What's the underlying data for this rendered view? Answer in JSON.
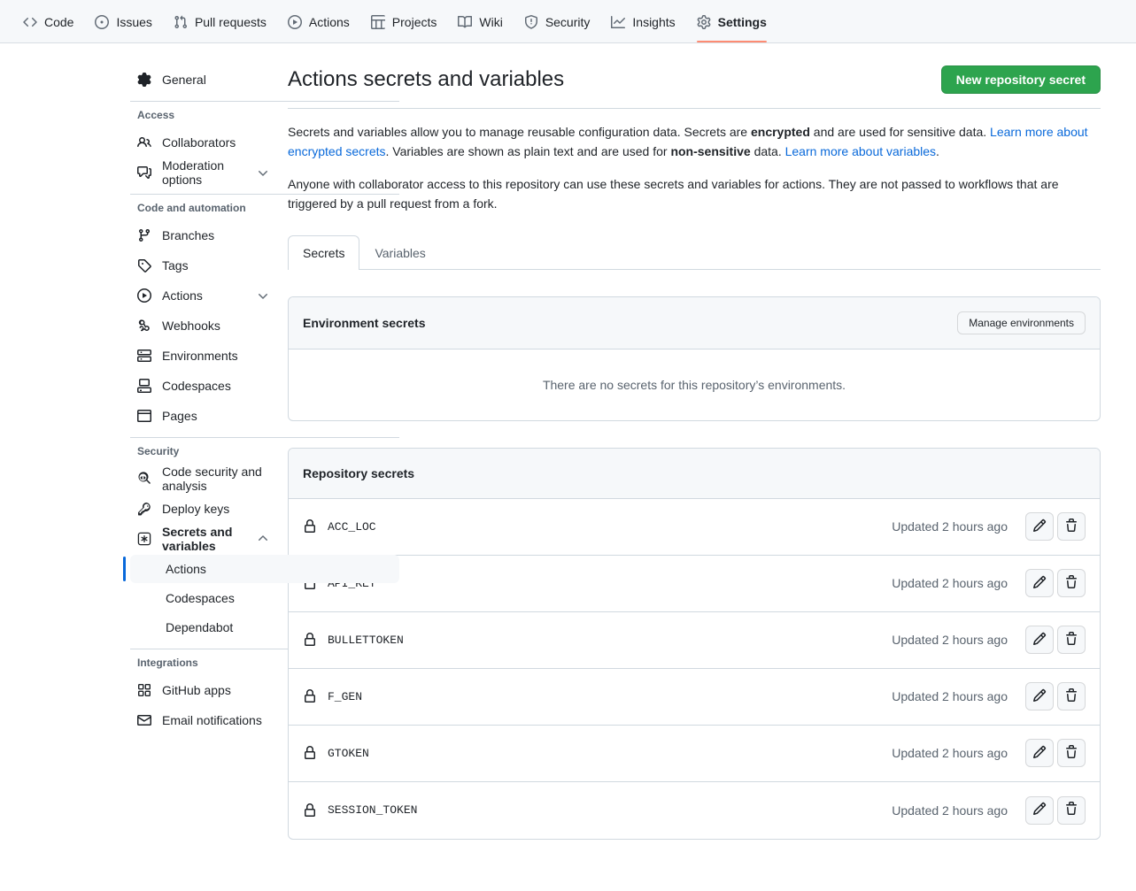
{
  "repo_nav": {
    "tabs": [
      {
        "label": "Code",
        "icon": "code-icon",
        "active": false
      },
      {
        "label": "Issues",
        "icon": "issue-opened-icon",
        "active": false
      },
      {
        "label": "Pull requests",
        "icon": "git-pull-request-icon",
        "active": false
      },
      {
        "label": "Actions",
        "icon": "play-icon",
        "active": false
      },
      {
        "label": "Projects",
        "icon": "table-icon",
        "active": false
      },
      {
        "label": "Wiki",
        "icon": "book-icon",
        "active": false
      },
      {
        "label": "Security",
        "icon": "shield-icon",
        "active": false
      },
      {
        "label": "Insights",
        "icon": "graph-icon",
        "active": false
      },
      {
        "label": "Settings",
        "icon": "gear-icon",
        "active": true
      }
    ]
  },
  "sidebar": {
    "top_items": [
      {
        "label": "General",
        "icon": "gear-icon"
      }
    ],
    "sections": [
      {
        "heading": "Access",
        "items": [
          {
            "label": "Collaborators",
            "icon": "people-icon",
            "chevron": ""
          },
          {
            "label": "Moderation options",
            "icon": "comment-discussion-icon",
            "chevron": "chevron-down-icon"
          }
        ]
      },
      {
        "heading": "Code and automation",
        "items": [
          {
            "label": "Branches",
            "icon": "git-branch-icon",
            "chevron": ""
          },
          {
            "label": "Tags",
            "icon": "tag-icon",
            "chevron": ""
          },
          {
            "label": "Actions",
            "icon": "play-icon",
            "chevron": "chevron-down-icon"
          },
          {
            "label": "Webhooks",
            "icon": "webhook-icon",
            "chevron": ""
          },
          {
            "label": "Environments",
            "icon": "server-icon",
            "chevron": ""
          },
          {
            "label": "Codespaces",
            "icon": "codespaces-icon",
            "chevron": ""
          },
          {
            "label": "Pages",
            "icon": "browser-icon",
            "chevron": ""
          }
        ]
      },
      {
        "heading": "Security",
        "items": [
          {
            "label": "Code security and analysis",
            "icon": "codescan-icon",
            "chevron": ""
          },
          {
            "label": "Deploy keys",
            "icon": "key-icon",
            "chevron": ""
          },
          {
            "label": "Secrets and variables",
            "icon": "asterisk-box-icon",
            "chevron": "chevron-up-icon",
            "bold": true
          }
        ],
        "sub_items": [
          {
            "label": "Actions",
            "selected": true
          },
          {
            "label": "Codespaces",
            "selected": false
          },
          {
            "label": "Dependabot",
            "selected": false
          }
        ]
      },
      {
        "heading": "Integrations",
        "items": [
          {
            "label": "GitHub apps",
            "icon": "apps-icon",
            "chevron": ""
          },
          {
            "label": "Email notifications",
            "icon": "mail-icon",
            "chevron": ""
          }
        ]
      }
    ]
  },
  "main": {
    "title": "Actions secrets and variables",
    "new_secret_button": "New repository secret",
    "description": {
      "p1_part1": "Secrets and variables allow you to manage reusable configuration data. Secrets are ",
      "p1_bold1": "encrypted",
      "p1_part2": " and are used for sensitive data. ",
      "p1_link1": "Learn more about encrypted secrets",
      "p1_part3": ". Variables are shown as plain text and are used for ",
      "p1_bold2": "non-sensitive",
      "p1_part4": " data. ",
      "p1_link2": "Learn more about variables",
      "p1_part5": ".",
      "p2": "Anyone with collaborator access to this repository can use these secrets and variables for actions. They are not passed to workflows that are triggered by a pull request from a fork."
    },
    "tabs": [
      {
        "label": "Secrets",
        "selected": true
      },
      {
        "label": "Variables",
        "selected": false
      }
    ],
    "environment_secrets": {
      "title": "Environment secrets",
      "manage_button": "Manage environments",
      "empty_text": "There are no secrets for this repository’s environments."
    },
    "repository_secrets": {
      "title": "Repository secrets",
      "rows": [
        {
          "name": "ACC_LOC",
          "updated": "Updated 2 hours ago"
        },
        {
          "name": "API_KEY",
          "updated": "Updated 2 hours ago"
        },
        {
          "name": "BULLETTOKEN",
          "updated": "Updated 2 hours ago"
        },
        {
          "name": "F_GEN",
          "updated": "Updated 2 hours ago"
        },
        {
          "name": "GTOKEN",
          "updated": "Updated 2 hours ago"
        },
        {
          "name": "SESSION_TOKEN",
          "updated": "Updated 2 hours ago"
        }
      ],
      "edit_label": "pencil-icon",
      "delete_label": "trash-icon"
    }
  },
  "colors": {
    "accent": "#0969da",
    "success": "#2da44e",
    "active_tab_underline": "#fd8c73",
    "header_bg": "#f6f8fa",
    "border": "#d1d9e0",
    "muted_text": "#59636e"
  }
}
